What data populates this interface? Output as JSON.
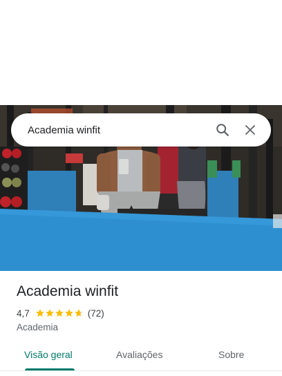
{
  "search": {
    "value": "Academia winfit",
    "search_icon": "search-icon",
    "close_icon": "close-icon"
  },
  "place": {
    "name": "Academia winfit",
    "rating": "4,7",
    "rating_value": 4.7,
    "rating_max": 5,
    "review_count": "(72)",
    "category": "Academia"
  },
  "tabs": [
    {
      "label": "Visão geral",
      "active": true
    },
    {
      "label": "Avaliações",
      "active": false
    },
    {
      "label": "Sobre",
      "active": false
    }
  ],
  "colors": {
    "accent": "#00796b",
    "star": "#fbbc04",
    "star_empty": "#dadce0"
  }
}
